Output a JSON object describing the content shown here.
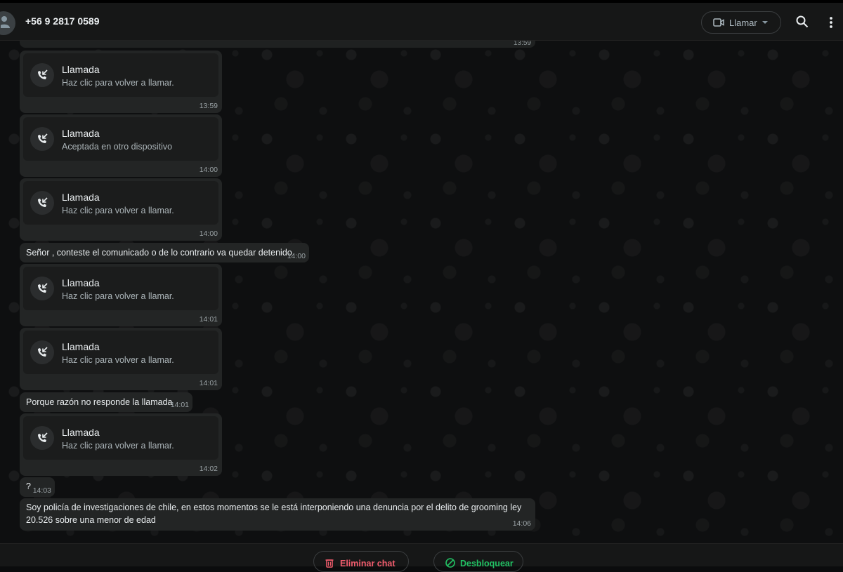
{
  "header": {
    "contact": "+56 9 2817 0589",
    "call_label": "Llamar"
  },
  "chat": {
    "first_partial_time": "13:59",
    "calls": [
      {
        "title": "Llamada",
        "subtitle": "Haz clic para volver a llamar.",
        "time": "13:59"
      },
      {
        "title": "Llamada",
        "subtitle": "Aceptada en otro dispositivo",
        "time": "14:00"
      },
      {
        "title": "Llamada",
        "subtitle": "Haz clic para volver a llamar.",
        "time": "14:00"
      },
      {
        "title": "Llamada",
        "subtitle": "Haz clic para volver a llamar.",
        "time": "14:01"
      },
      {
        "title": "Llamada",
        "subtitle": "Haz clic para volver a llamar.",
        "time": "14:01"
      },
      {
        "title": "Llamada",
        "subtitle": "Haz clic para volver a llamar.",
        "time": "14:02"
      }
    ],
    "texts": [
      {
        "text": "Señor , conteste el comunicado o de lo contrario va quedar detenido",
        "time": "14:00"
      },
      {
        "text": "Porque razón no responde la llamada",
        "time": "14:01"
      },
      {
        "text": "?",
        "time": "14:03"
      },
      {
        "line1": "Soy policía de investigaciones de chile, en estos momentos se le está interponiendo una denuncia por el delito de grooming ley",
        "line2": "20.526 sobre una menor de edad",
        "time": "14:06"
      }
    ]
  },
  "footer": {
    "delete_label": "Eliminar chat",
    "unblock_label": "Desbloquear"
  },
  "colors": {
    "delete": "#f15c6d",
    "unblock": "#21c063"
  }
}
